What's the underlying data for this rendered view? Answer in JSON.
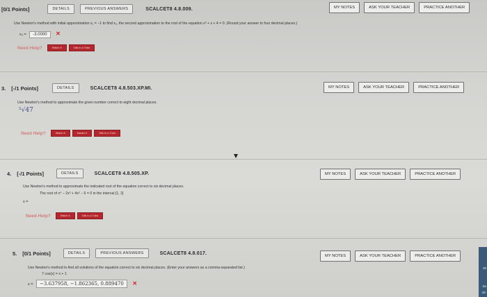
{
  "q1": {
    "points": "[0/1 Points]",
    "tabs": [
      "DETAILS",
      "PREVIOUS ANSWERS"
    ],
    "code": "SCALCET8 4.8.009.",
    "buttons": [
      "MY NOTES",
      "ASK YOUR TEACHER",
      "PRACTICE ANOTHER"
    ],
    "prompt": "Use Newton's method with initial approximation x₁ = −1 to find x₃, the second approximation to the root of the equation x³ + x + 4 = 0. (Round your answer to four decimal places.)",
    "answer_label": "x₃ =",
    "answer_value": "-3.0000",
    "need_help": "Need Help?",
    "help_buttons": [
      "Watch It",
      "Talk to a Tutor"
    ]
  },
  "q3": {
    "number": "3.",
    "points": "[-/1 Points]",
    "tabs": [
      "DETAILS"
    ],
    "code": "SCALCET8 4.8.503.XP.MI.",
    "buttons": [
      "MY NOTES",
      "ASK YOUR TEACHER",
      "PRACTICE ANOTHER"
    ],
    "prompt": "Use Newton's method to approximate the given number correct to eight decimal places.",
    "math": "⁵√47",
    "need_help": "Need Help?",
    "help_buttons": [
      "Watch It",
      "Master It",
      "Talk to a Tutor"
    ]
  },
  "q4": {
    "number": "4.",
    "points": "[-/1 Points]",
    "tabs": [
      "DETAILS"
    ],
    "code": "SCALCET8 4.8.505.XP.",
    "buttons": [
      "MY NOTES",
      "ASK YOUR TEACHER",
      "PRACTICE ANOTHER"
    ],
    "prompt": "Use Newton's method to approximate the indicated root of the equation correct to six decimal places.",
    "subprompt": "The root of x⁴ − 2x³ + 4x² − 6 = 0 in the interval [1, 2]",
    "answer_label": "x =",
    "need_help": "Need Help?",
    "help_buttons": [
      "Watch It",
      "Talk to a Tutor"
    ]
  },
  "q5": {
    "number": "5.",
    "points": "[0/1 Points]",
    "tabs": [
      "DETAILS",
      "PREVIOUS ANSWERS"
    ],
    "code": "SCALCET8 4.8.017.",
    "buttons": [
      "MY NOTES",
      "ASK YOUR TEACHER",
      "PRACTICE ANOTHER"
    ],
    "prompt": "Use Newton's method to find all solutions of the equation correct to six decimal places. (Enter your answers as a comma-separated list.)",
    "equation": "7 cos(x) = x + 1",
    "answer_label": "x =",
    "answer_value": "−3.637958, −1.862365, 0.889470"
  },
  "taskbar": {
    "line1": "20",
    "line2": "Se",
    "line3": "20-"
  },
  "colors": {
    "error": "#c8242a",
    "help_button": "#b3272d",
    "need_help": "#d27d7d"
  }
}
